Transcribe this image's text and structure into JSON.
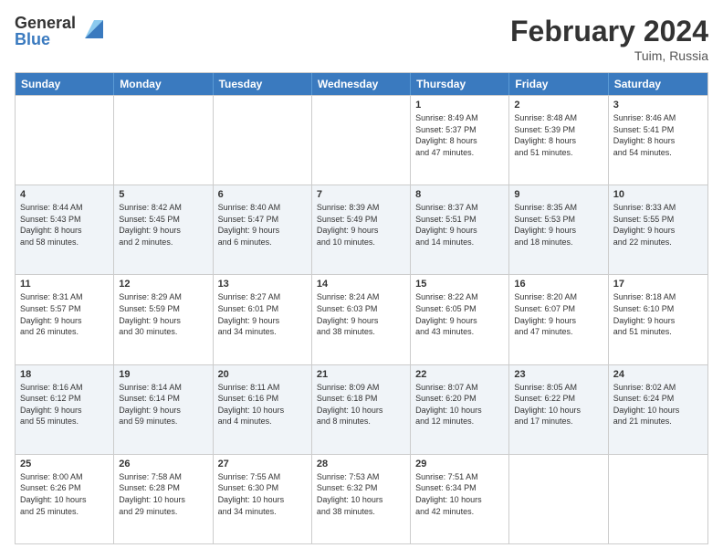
{
  "header": {
    "logo_general": "General",
    "logo_blue": "Blue",
    "month_title": "February 2024",
    "location": "Tuim, Russia"
  },
  "days_of_week": [
    "Sunday",
    "Monday",
    "Tuesday",
    "Wednesday",
    "Thursday",
    "Friday",
    "Saturday"
  ],
  "weeks": [
    {
      "cells": [
        {
          "day": "",
          "empty": true,
          "info": ""
        },
        {
          "day": "",
          "empty": true,
          "info": ""
        },
        {
          "day": "",
          "empty": true,
          "info": ""
        },
        {
          "day": "",
          "empty": true,
          "info": ""
        },
        {
          "day": "1",
          "empty": false,
          "info": "Sunrise: 8:49 AM\nSunset: 5:37 PM\nDaylight: 8 hours\nand 47 minutes."
        },
        {
          "day": "2",
          "empty": false,
          "info": "Sunrise: 8:48 AM\nSunset: 5:39 PM\nDaylight: 8 hours\nand 51 minutes."
        },
        {
          "day": "3",
          "empty": false,
          "info": "Sunrise: 8:46 AM\nSunset: 5:41 PM\nDaylight: 8 hours\nand 54 minutes."
        }
      ]
    },
    {
      "cells": [
        {
          "day": "4",
          "empty": false,
          "info": "Sunrise: 8:44 AM\nSunset: 5:43 PM\nDaylight: 8 hours\nand 58 minutes."
        },
        {
          "day": "5",
          "empty": false,
          "info": "Sunrise: 8:42 AM\nSunset: 5:45 PM\nDaylight: 9 hours\nand 2 minutes."
        },
        {
          "day": "6",
          "empty": false,
          "info": "Sunrise: 8:40 AM\nSunset: 5:47 PM\nDaylight: 9 hours\nand 6 minutes."
        },
        {
          "day": "7",
          "empty": false,
          "info": "Sunrise: 8:39 AM\nSunset: 5:49 PM\nDaylight: 9 hours\nand 10 minutes."
        },
        {
          "day": "8",
          "empty": false,
          "info": "Sunrise: 8:37 AM\nSunset: 5:51 PM\nDaylight: 9 hours\nand 14 minutes."
        },
        {
          "day": "9",
          "empty": false,
          "info": "Sunrise: 8:35 AM\nSunset: 5:53 PM\nDaylight: 9 hours\nand 18 minutes."
        },
        {
          "day": "10",
          "empty": false,
          "info": "Sunrise: 8:33 AM\nSunset: 5:55 PM\nDaylight: 9 hours\nand 22 minutes."
        }
      ]
    },
    {
      "cells": [
        {
          "day": "11",
          "empty": false,
          "info": "Sunrise: 8:31 AM\nSunset: 5:57 PM\nDaylight: 9 hours\nand 26 minutes."
        },
        {
          "day": "12",
          "empty": false,
          "info": "Sunrise: 8:29 AM\nSunset: 5:59 PM\nDaylight: 9 hours\nand 30 minutes."
        },
        {
          "day": "13",
          "empty": false,
          "info": "Sunrise: 8:27 AM\nSunset: 6:01 PM\nDaylight: 9 hours\nand 34 minutes."
        },
        {
          "day": "14",
          "empty": false,
          "info": "Sunrise: 8:24 AM\nSunset: 6:03 PM\nDaylight: 9 hours\nand 38 minutes."
        },
        {
          "day": "15",
          "empty": false,
          "info": "Sunrise: 8:22 AM\nSunset: 6:05 PM\nDaylight: 9 hours\nand 43 minutes."
        },
        {
          "day": "16",
          "empty": false,
          "info": "Sunrise: 8:20 AM\nSunset: 6:07 PM\nDaylight: 9 hours\nand 47 minutes."
        },
        {
          "day": "17",
          "empty": false,
          "info": "Sunrise: 8:18 AM\nSunset: 6:10 PM\nDaylight: 9 hours\nand 51 minutes."
        }
      ]
    },
    {
      "cells": [
        {
          "day": "18",
          "empty": false,
          "info": "Sunrise: 8:16 AM\nSunset: 6:12 PM\nDaylight: 9 hours\nand 55 minutes."
        },
        {
          "day": "19",
          "empty": false,
          "info": "Sunrise: 8:14 AM\nSunset: 6:14 PM\nDaylight: 9 hours\nand 59 minutes."
        },
        {
          "day": "20",
          "empty": false,
          "info": "Sunrise: 8:11 AM\nSunset: 6:16 PM\nDaylight: 10 hours\nand 4 minutes."
        },
        {
          "day": "21",
          "empty": false,
          "info": "Sunrise: 8:09 AM\nSunset: 6:18 PM\nDaylight: 10 hours\nand 8 minutes."
        },
        {
          "day": "22",
          "empty": false,
          "info": "Sunrise: 8:07 AM\nSunset: 6:20 PM\nDaylight: 10 hours\nand 12 minutes."
        },
        {
          "day": "23",
          "empty": false,
          "info": "Sunrise: 8:05 AM\nSunset: 6:22 PM\nDaylight: 10 hours\nand 17 minutes."
        },
        {
          "day": "24",
          "empty": false,
          "info": "Sunrise: 8:02 AM\nSunset: 6:24 PM\nDaylight: 10 hours\nand 21 minutes."
        }
      ]
    },
    {
      "cells": [
        {
          "day": "25",
          "empty": false,
          "info": "Sunrise: 8:00 AM\nSunset: 6:26 PM\nDaylight: 10 hours\nand 25 minutes."
        },
        {
          "day": "26",
          "empty": false,
          "info": "Sunrise: 7:58 AM\nSunset: 6:28 PM\nDaylight: 10 hours\nand 29 minutes."
        },
        {
          "day": "27",
          "empty": false,
          "info": "Sunrise: 7:55 AM\nSunset: 6:30 PM\nDaylight: 10 hours\nand 34 minutes."
        },
        {
          "day": "28",
          "empty": false,
          "info": "Sunrise: 7:53 AM\nSunset: 6:32 PM\nDaylight: 10 hours\nand 38 minutes."
        },
        {
          "day": "29",
          "empty": false,
          "info": "Sunrise: 7:51 AM\nSunset: 6:34 PM\nDaylight: 10 hours\nand 42 minutes."
        },
        {
          "day": "",
          "empty": true,
          "info": ""
        },
        {
          "day": "",
          "empty": true,
          "info": ""
        }
      ]
    }
  ]
}
